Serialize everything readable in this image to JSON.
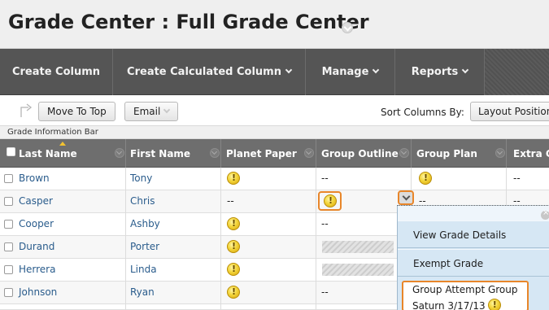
{
  "page": {
    "title": "Grade Center : Full Grade Center"
  },
  "action_bar": {
    "items": [
      {
        "label": "Create Column",
        "has_menu": false
      },
      {
        "label": "Create Calculated Column",
        "has_menu": true
      },
      {
        "label": "Manage",
        "has_menu": true
      },
      {
        "label": "Reports",
        "has_menu": true
      }
    ]
  },
  "toolbar": {
    "move_to_top": "Move To Top",
    "email": "Email",
    "sort_label": "Sort Columns By:",
    "sort_value": "Layout Position"
  },
  "info_bar": {
    "label": "Grade Information Bar"
  },
  "grid": {
    "columns": [
      "Last Name",
      "First Name",
      "Planet Paper",
      "Group Outline",
      "Group Plan",
      "Extra C"
    ],
    "rows": [
      {
        "last": "Brown",
        "first": "Tony",
        "planet": "icon",
        "outline": "--",
        "plan": "icon",
        "extra": "--"
      },
      {
        "last": "Casper",
        "first": "Chris",
        "planet": "--",
        "outline": "icon",
        "plan": "--",
        "extra": "--"
      },
      {
        "last": "Cooper",
        "first": "Ashby",
        "planet": "icon",
        "outline": "--",
        "plan": "",
        "extra": ""
      },
      {
        "last": "Durand",
        "first": "Porter",
        "planet": "icon",
        "outline": "hatched",
        "plan": "",
        "extra": ""
      },
      {
        "last": "Herrera",
        "first": "Linda",
        "planet": "icon",
        "outline": "hatched",
        "plan": "",
        "extra": ""
      },
      {
        "last": "Johnson",
        "first": "Ryan",
        "planet": "icon",
        "outline": "--",
        "plan": "",
        "extra": ""
      }
    ]
  },
  "context_menu": {
    "items": [
      "View Grade Details",
      "Exempt Grade"
    ],
    "attempt_line1": "Group Attempt Group",
    "attempt_line2": "Saturn 3/17/13"
  },
  "colors": {
    "action_bar": "#555555",
    "grid_header": "#6e6e6e",
    "link": "#2a5c8c",
    "highlight": "#e8862a",
    "menu_bg": "#d6e7f4"
  },
  "icons": [
    "needs-grading-icon",
    "chevron-down-icon",
    "close-icon",
    "move-arrow-icon"
  ]
}
